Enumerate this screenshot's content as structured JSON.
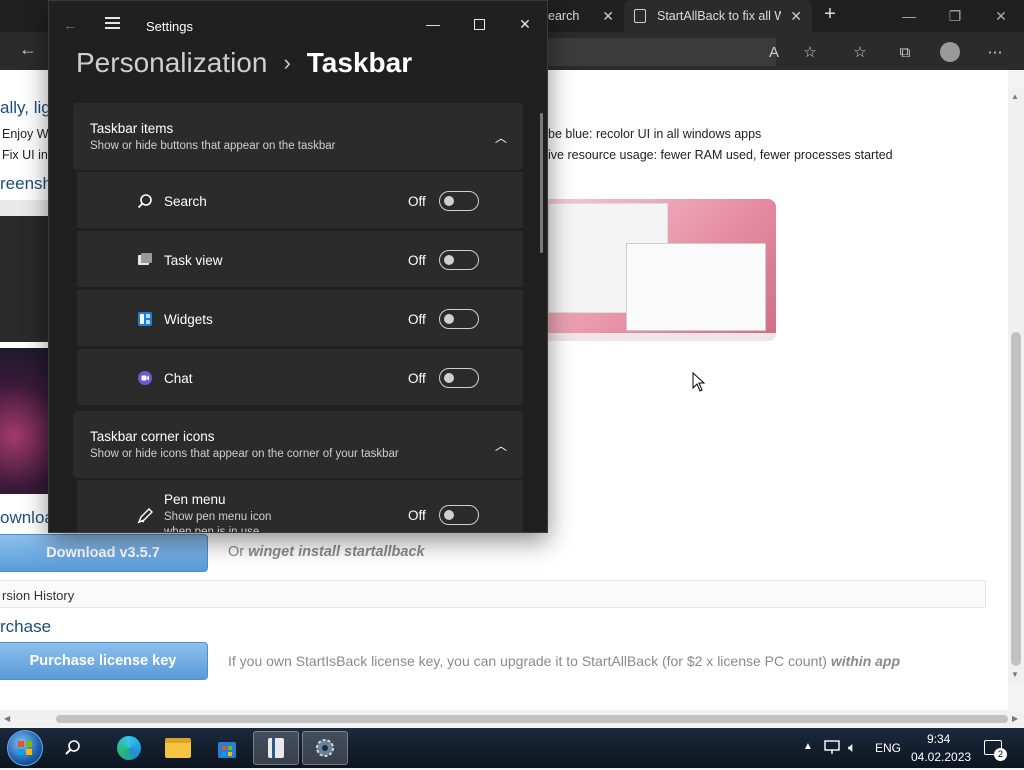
{
  "browser": {
    "tabs": [
      {
        "label": "earch"
      },
      {
        "label": "StartAllBack to fix all W"
      }
    ],
    "new_tab": "+",
    "toolbar_icons": [
      "back-icon",
      "read-aloud-icon",
      "add-favorite-icon",
      "favorites-icon",
      "collections-icon",
      "profile-icon",
      "more-icon"
    ]
  },
  "page": {
    "left_fragments": [
      "ally, lig",
      "Enjoy W",
      "Fix UI in",
      "reensh",
      "ownloa"
    ],
    "feature_1": "be blue: recolor UI in all windows apps",
    "feature_2": "ive resource usage: fewer RAM used, fewer processes started",
    "download_button": "Download v3.5.7",
    "winget_prefix": "Or ",
    "winget_cmd": "winget install startallback",
    "version_history": "rsion History",
    "purchase_heading": "rchase",
    "purchase_button": "Purchase license key",
    "upgrade_text": "If you own StartIsBack license key, you can upgrade it to StartAllBack (for $2 x license PC count) ",
    "upgrade_emph": "within app"
  },
  "settings": {
    "window_title": "Settings",
    "breadcrumb_parent": "Personalization",
    "breadcrumb_sep": "›",
    "breadcrumb_current": "Taskbar",
    "taskbar_items": {
      "title": "Taskbar items",
      "subtitle": "Show or hide buttons that appear on the taskbar",
      "rows": [
        {
          "label": "Search",
          "state": "Off",
          "on": false
        },
        {
          "label": "Task view",
          "state": "Off",
          "on": false
        },
        {
          "label": "Widgets",
          "state": "Off",
          "on": false
        },
        {
          "label": "Chat",
          "state": "Off",
          "on": false
        }
      ]
    },
    "corner_icons": {
      "title": "Taskbar corner icons",
      "subtitle": "Show or hide icons that appear on the corner of your taskbar",
      "rows": [
        {
          "label": "Pen menu",
          "sub1": "Show pen menu icon",
          "sub2": "when pen is in use",
          "state": "Off",
          "on": false
        }
      ]
    }
  },
  "taskbar": {
    "apps": [
      "start-orb",
      "search-icon",
      "edge-icon",
      "file-explorer-icon",
      "store-icon",
      "book-app-icon",
      "settings-app-icon"
    ],
    "language": "ENG",
    "time": "9:34",
    "date": "04.02.2023",
    "notification_count": "2"
  },
  "colors": {
    "settings_bg": "#202020",
    "card_bg": "#2b2b2b",
    "link_blue": "#5a9ad8"
  }
}
